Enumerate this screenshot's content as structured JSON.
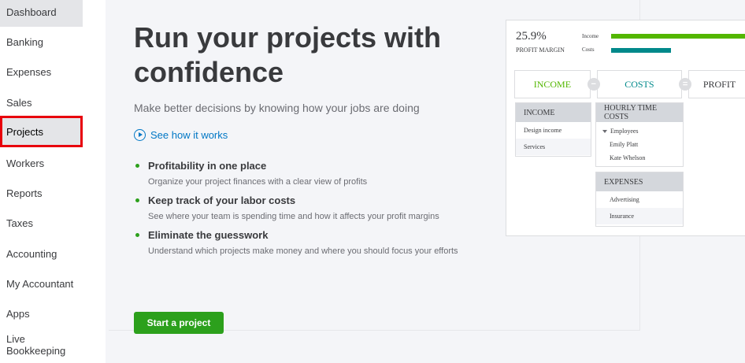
{
  "sidebar": {
    "items": [
      {
        "label": "Dashboard"
      },
      {
        "label": "Banking"
      },
      {
        "label": "Expenses"
      },
      {
        "label": "Sales"
      },
      {
        "label": "Projects"
      },
      {
        "label": "Workers"
      },
      {
        "label": "Reports"
      },
      {
        "label": "Taxes"
      },
      {
        "label": "Accounting"
      },
      {
        "label": "My Accountant"
      },
      {
        "label": "Apps"
      },
      {
        "label": "Live Bookkeeping"
      }
    ]
  },
  "main": {
    "headline": "Run your projects with confidence",
    "subtitle": "Make better decisions by knowing how your jobs are doing",
    "see_how": "See how it works",
    "features": [
      {
        "title": "Profitability in one place",
        "desc": "Organize your project finances with a clear view of profits"
      },
      {
        "title": "Keep track of your labor costs",
        "desc": "See where your team is spending time and how it affects your profit margins"
      },
      {
        "title": "Eliminate the guesswork",
        "desc": "Understand which projects make money and where you should focus your efforts"
      }
    ],
    "start_button": "Start a project"
  },
  "illustration": {
    "profit_margin_value": "25.9%",
    "profit_margin_label": "PROFIT MARGIN",
    "legend_income": "Income",
    "legend_costs": "Costs",
    "income_bar_fraction": 1.0,
    "costs_bar_fraction": 0.42,
    "equation": {
      "income": "INCOME",
      "minus": "−",
      "costs": "COSTS",
      "equals": "=",
      "profit": "PROFIT"
    },
    "income_panel": {
      "title": "INCOME",
      "rows": [
        "Design income",
        "Services"
      ]
    },
    "hourly_panel": {
      "title": "HOURLY TIME COSTS",
      "group": "Employees",
      "rows": [
        "Emily Platt",
        "Kate Whelson"
      ]
    },
    "expenses_panel": {
      "title": "EXPENSES",
      "rows": [
        "Advertising",
        "Insurance"
      ]
    },
    "colors": {
      "income": "#53b700",
      "costs": "#00898b",
      "accent": "#2ca01c",
      "link": "#0077c5",
      "highlight": "#e8000c"
    }
  }
}
